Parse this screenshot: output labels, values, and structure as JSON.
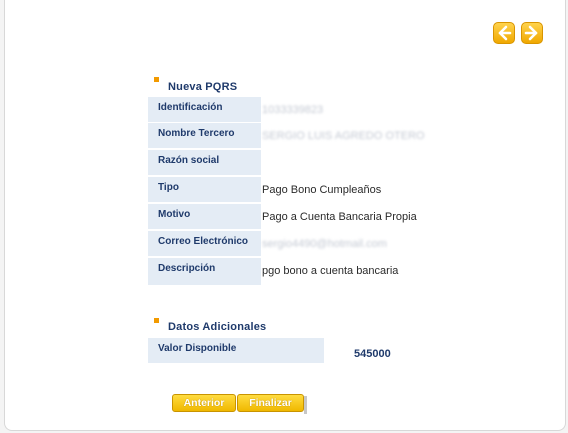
{
  "section_new": {
    "title": "Nueva PQRS"
  },
  "fields": [
    {
      "label": "Identificación",
      "value": "1033339823"
    },
    {
      "label": "Nombre Tercero",
      "value": "SERGIO LUIS AGREDO OTERO"
    },
    {
      "label": "Razón social",
      "value": ""
    },
    {
      "label": "Tipo",
      "value": "Pago Bono Cumpleaños"
    },
    {
      "label": "Motivo",
      "value": "Pago a Cuenta Bancaria Propia"
    },
    {
      "label": "Correo Electrónico",
      "value": "sergio4490@hotmail.com"
    },
    {
      "label": "Descripción",
      "value": "pgo bono a cuenta bancaria"
    }
  ],
  "section_additional": {
    "title": "Datos Adicionales"
  },
  "additional": {
    "label": "Valor Disponible",
    "value": "545000"
  },
  "buttons": {
    "previous": "Anterior",
    "finish": "Finalizar"
  },
  "icons": {
    "back": "arrow-left-icon",
    "forward": "arrow-right-icon"
  },
  "colors": {
    "accent": "#f0a800",
    "label_bg": "#e4ecf5",
    "label_text": "#1f3a6b"
  }
}
